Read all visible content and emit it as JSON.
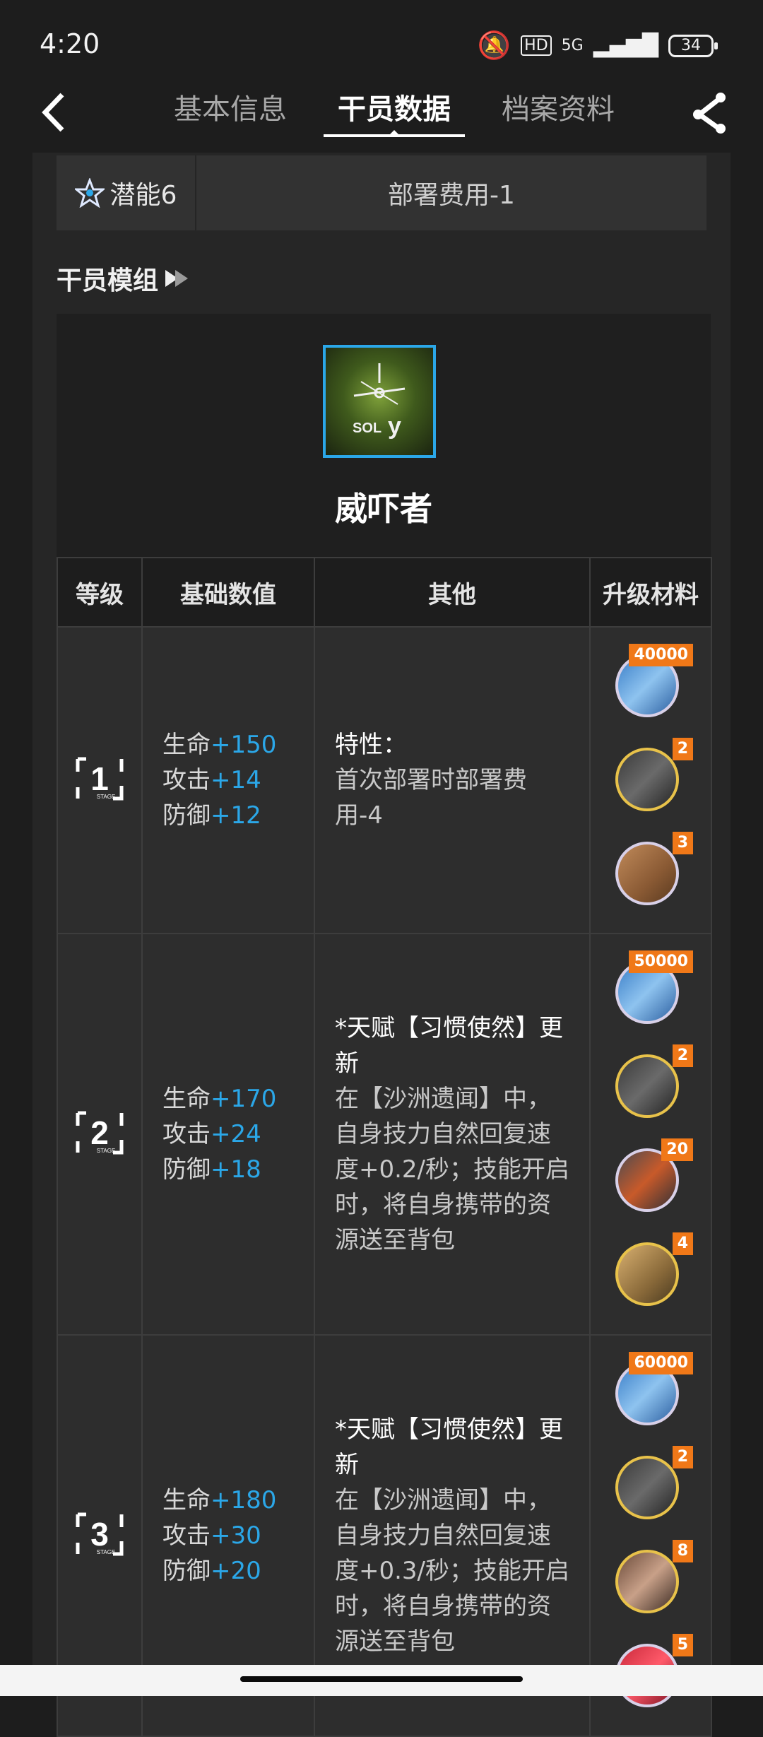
{
  "status": {
    "time": "4:20",
    "battery": "34",
    "hd": "HD",
    "network": "5G"
  },
  "tabs": [
    {
      "label": "基本信息"
    },
    {
      "label": "干员数据"
    },
    {
      "label": "档案资料"
    }
  ],
  "potential": {
    "label": "潜能6",
    "value": "部署费用-1"
  },
  "module_section": {
    "title": "干员模组",
    "icon_text": "SOL",
    "icon_letter": "y",
    "name": "威吓者"
  },
  "table": {
    "headers": [
      "等级",
      "基础数值",
      "其他",
      "升级材料"
    ],
    "rows": [
      {
        "stage": "1",
        "stage_label": "STAGE",
        "hp_label": "生命",
        "hp": "+150",
        "atk_label": "攻击",
        "atk": "+14",
        "def_label": "防御",
        "def": "+12",
        "other_title": "特性：",
        "other_text": "首次部署时部署费用-4",
        "materials": [
          {
            "name": "module-data-block",
            "count": "40000"
          },
          {
            "name": "module-data-chip",
            "count": "2"
          },
          {
            "name": "orirock-cluster",
            "count": "3"
          }
        ]
      },
      {
        "stage": "2",
        "stage_label": "STAGE",
        "hp_label": "生命",
        "hp": "+170",
        "atk_label": "攻击",
        "atk": "+24",
        "def_label": "防御",
        "def": "+18",
        "other_title": "*天赋【习惯使然】更新",
        "other_text": "在【沙洲遗闻】中，自身技力自然回复速度+0.2/秒；技能开启时，将自身携带的资源送至背包",
        "materials": [
          {
            "name": "module-data-block",
            "count": "50000"
          },
          {
            "name": "module-data-chip",
            "count": "2"
          },
          {
            "name": "device-material",
            "count": "20"
          },
          {
            "name": "manganese-material",
            "count": "4"
          }
        ]
      },
      {
        "stage": "3",
        "stage_label": "STAGE",
        "hp_label": "生命",
        "hp": "+180",
        "atk_label": "攻击",
        "atk": "+30",
        "def_label": "防御",
        "def": "+20",
        "other_title": "*天赋【习惯使然】更新",
        "other_text": "在【沙洲遗闻】中，自身技力自然回复速度+0.3/秒；技能开启时，将自身携带的资源送至背包",
        "materials": [
          {
            "name": "module-data-block",
            "count": "60000"
          },
          {
            "name": "module-data-chip",
            "count": "2"
          },
          {
            "name": "paper-material",
            "count": "8"
          },
          {
            "name": "crystal-material",
            "count": "5"
          }
        ]
      }
    ]
  },
  "colors": {
    "accent": "#2ba7e8",
    "badge": "#f07818"
  }
}
